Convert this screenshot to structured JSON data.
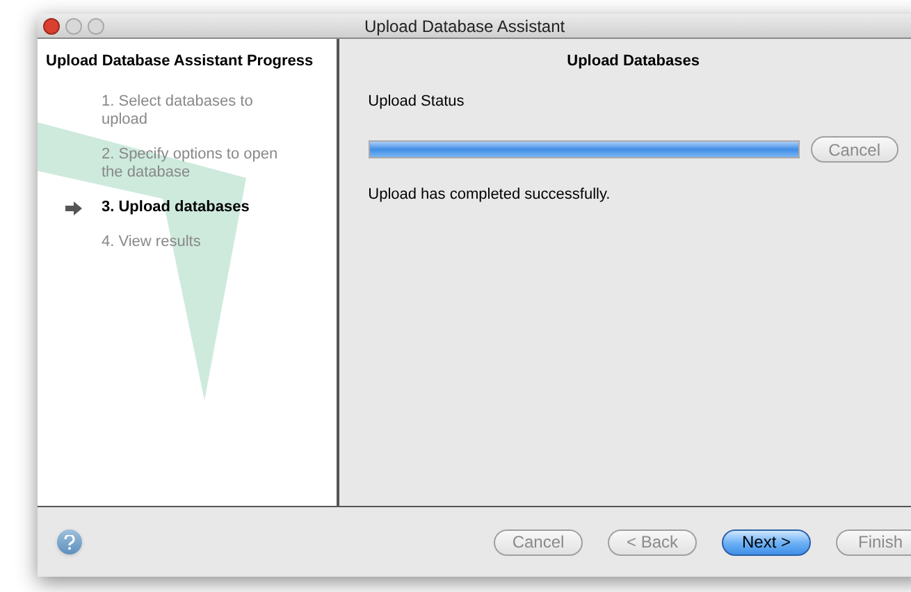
{
  "window": {
    "title": "Upload Database Assistant"
  },
  "sidebar": {
    "title": "Upload Database Assistant Progress",
    "steps": [
      {
        "label": "1. Select databases to upload",
        "selected": false
      },
      {
        "label": "2. Specify options to open the database",
        "selected": false
      },
      {
        "label": "3. Upload databases",
        "selected": true
      },
      {
        "label": "4. View results",
        "selected": false
      }
    ]
  },
  "panel": {
    "title": "Upload Databases",
    "status_label": "Upload Status",
    "progress": {
      "level": 1
    },
    "cancel": {
      "label": "Cancel",
      "disabled": true
    },
    "message": "Upload has completed successfully."
  },
  "buttons": [
    {
      "label": "Cancel",
      "disabled": true,
      "default": false
    },
    {
      "label": "< Back",
      "disabled": true,
      "default": false
    },
    {
      "label": "Next >",
      "disabled": false,
      "default": true
    },
    {
      "label": "Finish",
      "disabled": true,
      "default": false
    }
  ]
}
